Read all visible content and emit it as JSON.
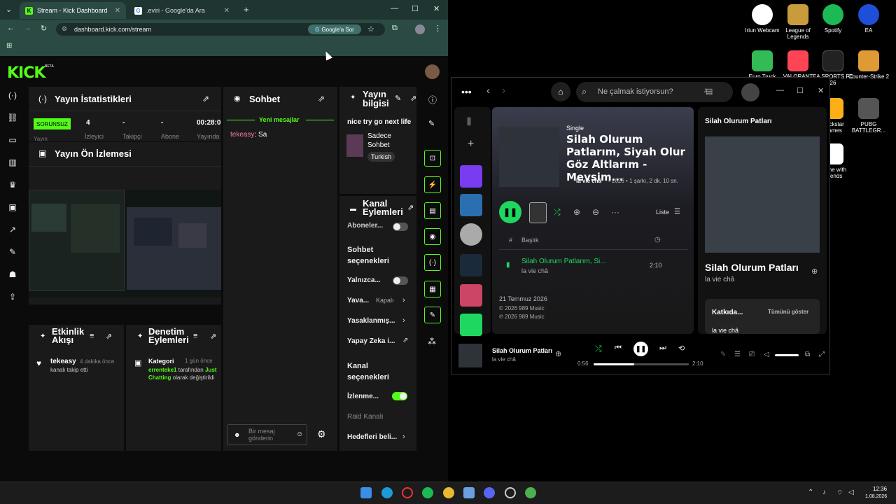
{
  "browser": {
    "tabs": [
      {
        "label": "Stream - Kick Dashboard",
        "favicon": "K"
      },
      {
        "label": "‎.eviri - Google'da Ara",
        "favicon": "G"
      }
    ],
    "url": "dashboard.kick.com/stream",
    "google_ask": "Google'a Sor"
  },
  "kick": {
    "logo": "KICK",
    "beta": "BETA",
    "stats": {
      "title": "Yayın İstatistikleri",
      "badge": "SORUNSUZ",
      "badge_sub": "Yayın",
      "items": [
        {
          "value": "4",
          "label": "İzleyici"
        },
        {
          "value": "-",
          "label": "Takipçi"
        },
        {
          "value": "-",
          "label": "Abone"
        },
        {
          "value": "00:28:0",
          "label": "Yayında"
        }
      ]
    },
    "preview": {
      "title": "Yayın Ön İzlemesi"
    },
    "chat": {
      "title": "Sohbet",
      "new_messages": "Yeni mesajlar",
      "messages": [
        {
          "user": "tekeasy",
          "text": "Sa"
        }
      ],
      "input_placeholder": "Bir mesaj gönderin"
    },
    "info": {
      "title": "Yayın bilgisi",
      "stream_title": "nice try go next life",
      "category": "Sadece Sohbet",
      "language": "Turkish"
    },
    "actions": {
      "title": "Kanal Eylemleri",
      "subs_row": "Aboneler...",
      "chat_section": "Sohbet seçenekleri",
      "rows": [
        {
          "label": "Yalnızca...",
          "kind": "toggle"
        },
        {
          "label": "Yava...",
          "value": "Kapalı",
          "kind": "chevron"
        },
        {
          "label": "Yasaklanmış...",
          "kind": "chevron"
        },
        {
          "label": "Yapay Zeka i...",
          "kind": "link"
        }
      ],
      "channel_section": "Kanal seçenekleri",
      "channel_rows": [
        {
          "label": "İzlenme...",
          "kind": "toggle-on"
        },
        {
          "label": "Raid Kanalı",
          "kind": "disabled"
        },
        {
          "label": "Hedefleri beli...",
          "kind": "chevron"
        }
      ]
    },
    "activity": {
      "title": "Etkinlik Akışı",
      "item_user": "tekeasy",
      "item_time": "4 dakika önce",
      "item_text": "kanalı takip etti"
    },
    "moderation": {
      "title": "Denetim Eylemleri",
      "item_title": "Kategori",
      "item_time": "1 gün önce",
      "item_user": "errenteke1",
      "item_mid": "tarafından",
      "item_cat": "Just Chatting",
      "item_end": "olarak değiştirildi"
    }
  },
  "desktop": {
    "icons": [
      {
        "label": "Iriun Webcam",
        "color": "#ffffff"
      },
      {
        "label": "League of Legends",
        "color": "#c89b3c"
      },
      {
        "label": "Spotify",
        "color": "#1db954"
      },
      {
        "label": "EA",
        "color": "#1e4fd8"
      },
      {
        "label": "Euro Truck",
        "color": "#3b5"
      },
      {
        "label": "VALORANT",
        "color": "#fd4556"
      },
      {
        "label": "EA SPORTS FC 26",
        "color": "#222"
      },
      {
        "label": "Counter-Strike 2",
        "color": "#de9b35"
      },
      {
        "label": "Rockstar Games",
        "color": "#fcaf17"
      },
      {
        "label": "PUBG BATTLEGR...",
        "color": "#555"
      },
      {
        "label": "Game with Friends",
        "color": "#fff"
      }
    ]
  },
  "spotify": {
    "search_placeholder": "Ne çalmak istiyorsun?",
    "type": "Single",
    "title": "Silah Olurum Patlarım, Siyah Olur Göz Altlarım - Mevsim...",
    "artist": "la vie châ",
    "meta": "• 2026 • 1 şarkı, 2 dk. 10 sn.",
    "list_label": "Liste",
    "col_title": "Başlık",
    "track_title": "Silah Olurum Patlarım, Si...",
    "track_artist": "la vie châ",
    "track_duration": "2:10",
    "release_date": "21 Temmuz 2026",
    "copyright1": "© 2026 989 Music",
    "copyright2": "℗ 2026 989 Music",
    "np_panel_title": "Silah Olurum Patları",
    "np_big_title": "Silah Olurum Patları",
    "np_artist": "la vie châ",
    "credits_label": "Katkıda...",
    "show_all": "Tümünü göster",
    "credits_artist": "la vie châ",
    "player_title": "Silah Olurum Patları",
    "player_artist": "la vie châ",
    "elapsed": "0:56",
    "total": "2:10",
    "progress": 0.43
  },
  "taskbar": {
    "time": "12:36",
    "date": "1.08.2026"
  }
}
